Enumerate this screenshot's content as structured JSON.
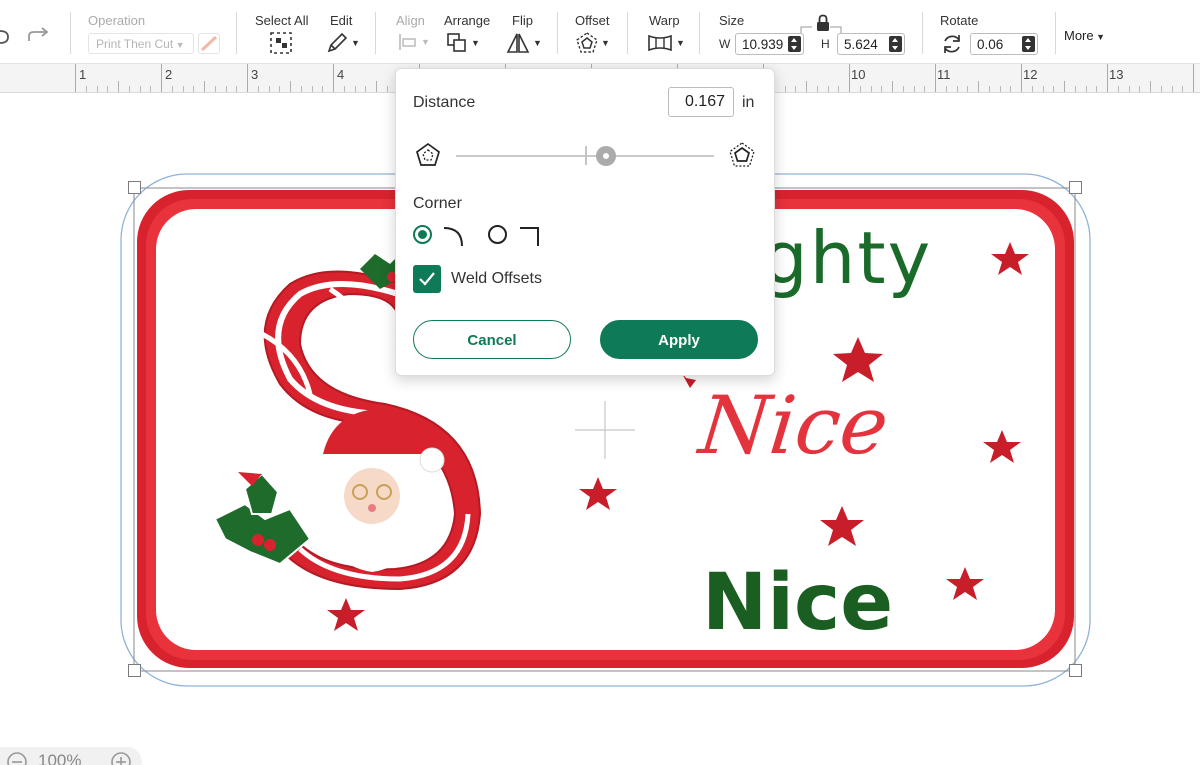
{
  "toolbar": {
    "operation_label": "Operation",
    "operation_value": "Print Then Cut",
    "select_all_label": "Select All",
    "edit_label": "Edit",
    "align_label": "Align",
    "arrange_label": "Arrange",
    "flip_label": "Flip",
    "offset_label": "Offset",
    "warp_label": "Warp",
    "size_label": "Size",
    "width_label": "W",
    "width_value": "10.939",
    "height_label": "H",
    "height_value": "5.624",
    "rotate_label": "Rotate",
    "rotate_value": "0.06",
    "more_label": "More"
  },
  "ruler": {
    "numbers": [
      "1",
      "2",
      "3",
      "4",
      "10",
      "11",
      "12",
      "13"
    ]
  },
  "offset_panel": {
    "distance_label": "Distance",
    "distance_value": "0.167",
    "unit": "in",
    "corner_label": "Corner",
    "corner_selected": "rounded",
    "weld_label": "Weld Offsets",
    "weld_checked": true,
    "cancel_label": "Cancel",
    "apply_label": "Apply",
    "slider_value_percent": 58
  },
  "canvas": {
    "text_naughty": "ghty",
    "text_nice_red": "Nice",
    "text_nice_green": "Nice",
    "zoom_text": "100%"
  },
  "colors": {
    "accent": "#0e7a57",
    "frame_red": "#d8232f",
    "text_green": "#1a6a2a",
    "text_red": "#e3343e"
  }
}
